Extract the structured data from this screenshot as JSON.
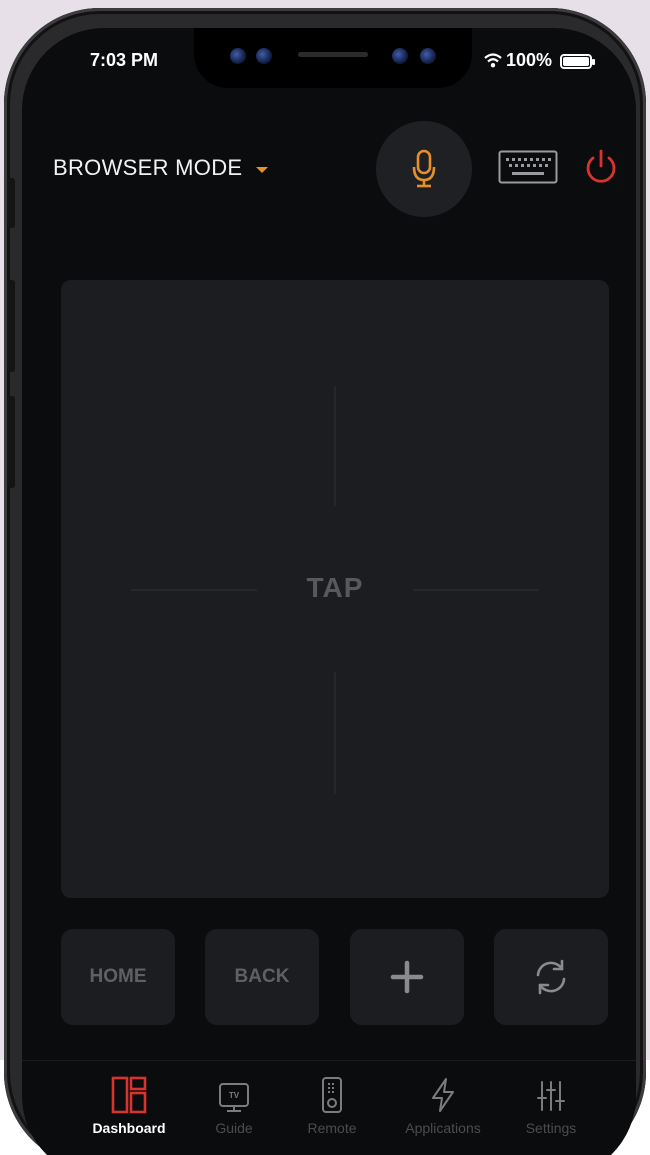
{
  "status_bar": {
    "time": "7:03 PM",
    "battery": "100%",
    "battery_level": 1.0
  },
  "header": {
    "mode_label": "BROWSER MODE",
    "mic_icon": "microphone-icon",
    "keyboard_icon": "keyboard-icon",
    "power_icon": "power-icon"
  },
  "touchpad": {
    "label": "TAP"
  },
  "controls": {
    "home": "HOME",
    "back": "BACK",
    "add_icon": "plus-icon",
    "refresh_icon": "refresh-icon"
  },
  "tabs": [
    {
      "label": "Dashboard",
      "icon": "dashboard-icon",
      "active": true
    },
    {
      "label": "Guide",
      "icon": "tv-icon",
      "active": false
    },
    {
      "label": "Remote",
      "icon": "remote-icon",
      "active": false
    },
    {
      "label": "Applications",
      "icon": "lightning-icon",
      "active": false
    },
    {
      "label": "Settings",
      "icon": "sliders-icon",
      "active": false
    }
  ],
  "colors": {
    "accent": "#e6902b",
    "power": "#d8332f",
    "active_tab": "#d8332f",
    "background": "#0b0c0d"
  }
}
